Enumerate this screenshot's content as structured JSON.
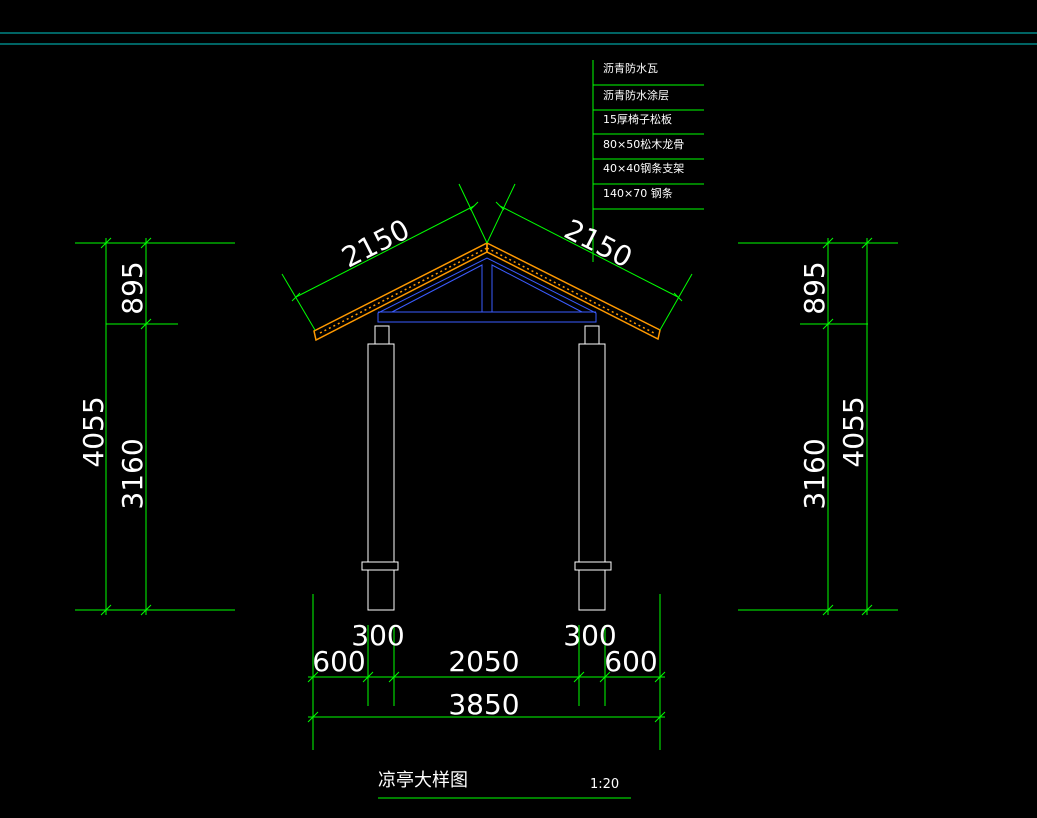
{
  "material_notes": [
    "沥青防水瓦",
    "沥青防水涂层",
    "15厚椅子松板",
    "80×50松木龙骨",
    "40×40钢条支架",
    "140×70 钢条"
  ],
  "dimensions": {
    "roof_slope_left": "2150",
    "roof_slope_right": "2150",
    "left_total_height": "4055",
    "left_roof_height": "895",
    "left_column_height": "3160",
    "right_total_height": "4055",
    "right_roof_height": "895",
    "right_column_height": "3160",
    "column_width_left": "300",
    "column_width_right": "300",
    "overhang_left": "600",
    "column_spacing": "2050",
    "overhang_right": "600",
    "total_width": "3850"
  },
  "title_block": {
    "title": "凉亭大样图",
    "scale": "1:20"
  },
  "colors": {
    "background": "#000000",
    "dimension_lines": "#00ff00",
    "outline": "#ffffff",
    "frame": "#00c8c8",
    "steel": "#3a5cff",
    "roof_tile": "#ff9900"
  }
}
